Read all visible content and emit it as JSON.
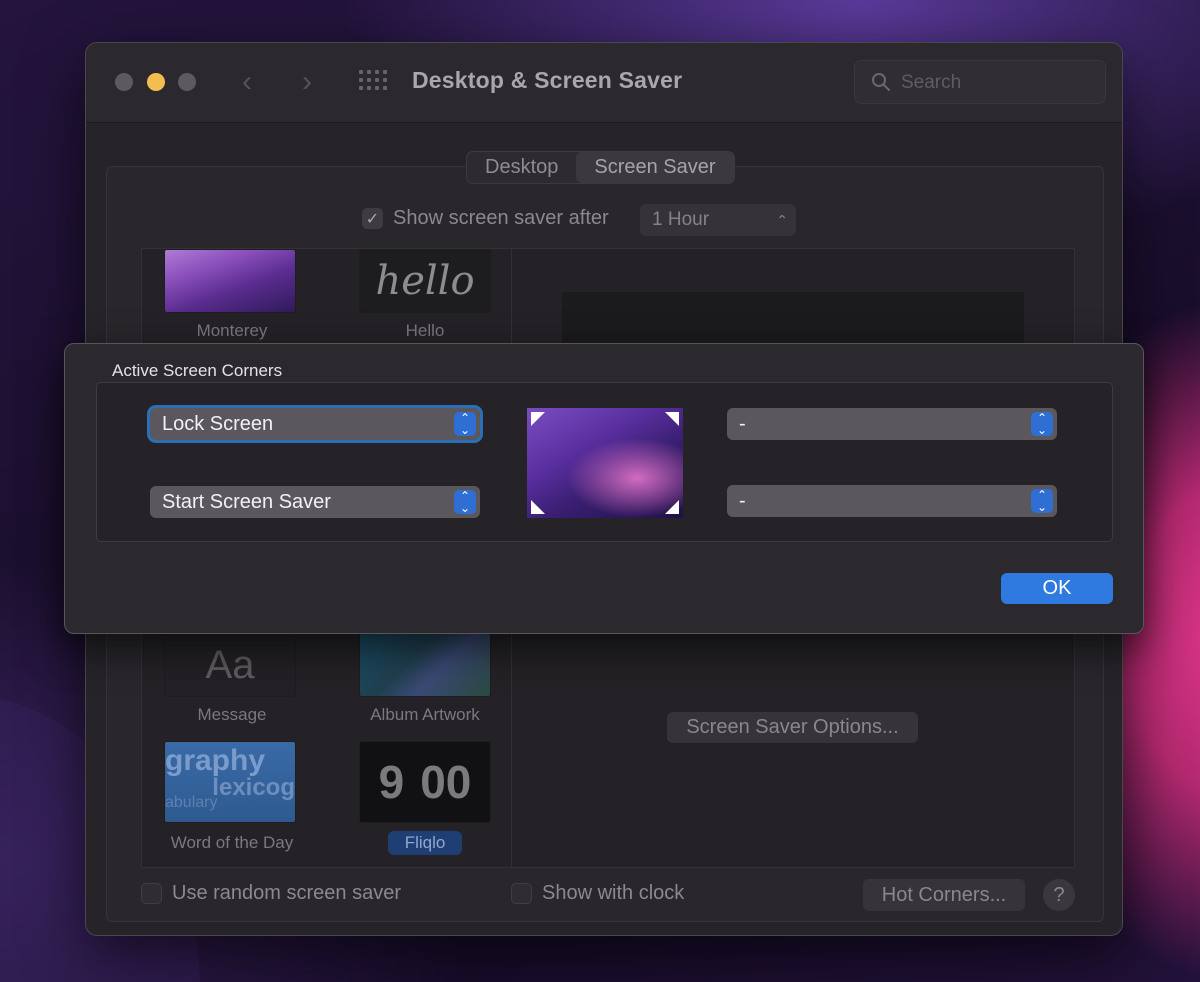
{
  "window": {
    "title": "Desktop & Screen Saver",
    "search_placeholder": "Search"
  },
  "nav": {
    "back": "‹",
    "forward": "›"
  },
  "tabs": [
    {
      "label": "Desktop",
      "active": false
    },
    {
      "label": "Screen Saver",
      "active": true
    }
  ],
  "show_after": {
    "label": "Show screen saver after",
    "checked": true,
    "value": "1 Hour"
  },
  "savers": [
    {
      "name": "Monterey"
    },
    {
      "name": "Hello",
      "thumb_text": "hello"
    },
    {
      "name": "Message",
      "thumb_text": "Aa"
    },
    {
      "name": "Album Artwork"
    },
    {
      "name": "Word of the Day",
      "thumb_words": [
        "graphy",
        "lexicog",
        "abulary"
      ]
    },
    {
      "name": "Fliqlo",
      "selected": true,
      "thumb_digits": [
        "9",
        "00"
      ]
    }
  ],
  "preview": {
    "options_button": "Screen Saver Options..."
  },
  "bottom": {
    "random_label": "Use random screen saver",
    "clock_label": "Show with clock",
    "hot_corners_button": "Hot Corners...",
    "help": "?"
  },
  "dialog": {
    "title": "Active Screen Corners",
    "top_left": "Lock Screen",
    "bottom_left": "Start Screen Saver",
    "top_right": "-",
    "bottom_right": "-",
    "ok": "OK"
  },
  "colors": {
    "accent": "#2f7ae0",
    "selected_badge": "#1f3f74",
    "traffic_yellow": "#f4bd4f"
  }
}
